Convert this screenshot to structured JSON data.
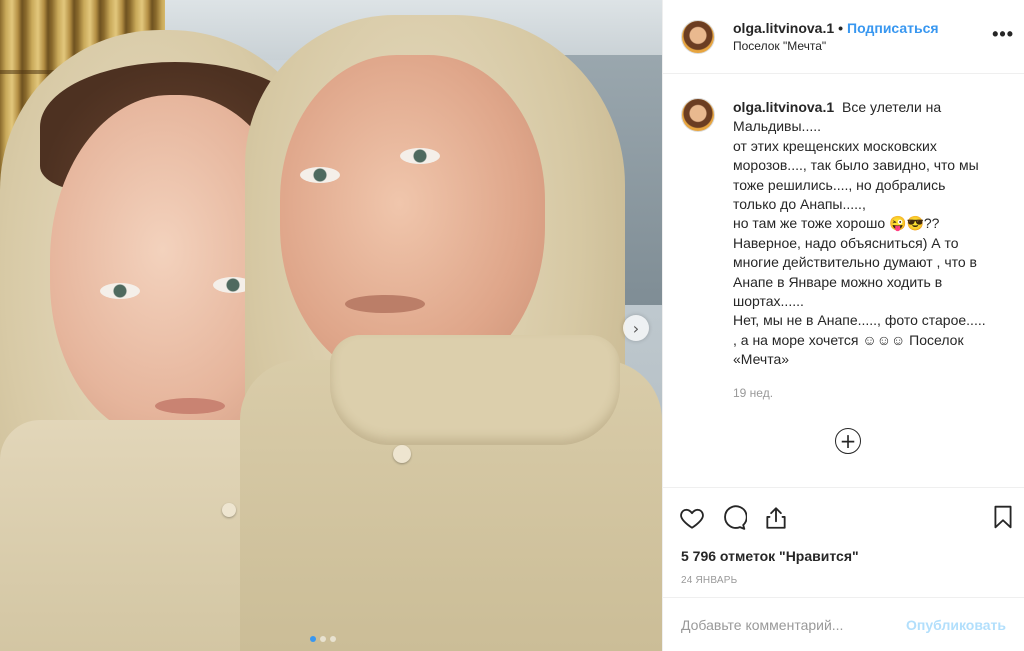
{
  "post": {
    "photo": {
      "carousel_dots": 3,
      "active_dot": 0,
      "next_icon": "chevron-right-icon"
    },
    "header": {
      "username": "olga.litvinova.1",
      "separator": "•",
      "follow_label": "Подписаться",
      "location": "Поселок \"Мечта\"",
      "more_icon": "more-dots-icon",
      "more_label": "•••"
    },
    "caption": {
      "username": "olga.litvinova.1",
      "lines": [
        "Все улетели на",
        "Мальдивы.....",
        "от этих крещенских московских",
        "морозов...., так было завидно, что мы",
        "тоже решились...., но добрались",
        "только до Анапы.....,",
        "но там же тоже хорошо 😜😎??",
        "Наверное, надо объясниться) А то",
        "многие действительно думают , что в",
        "Анапе в Январе можно ходить в",
        "шортах......",
        "Нет, мы не в Анапе....., фото старое.....",
        ", а на море хочется ☺☺☺ Поселок",
        "«Мечта»"
      ],
      "time": "19 нед."
    },
    "load_more_icon": "plus-circle-icon",
    "load_more_label": "+",
    "actions": {
      "like_icon": "heart-icon",
      "comment_icon": "comment-bubble-icon",
      "share_icon": "share-upload-icon",
      "save_icon": "bookmark-icon"
    },
    "likes_text": "5 796 отметок \"Нравится\"",
    "date": "24 ЯНВАРЬ",
    "comment_box": {
      "placeholder": "Добавьте комментарий...",
      "publish_label": "Опубликовать"
    },
    "colors": {
      "accent": "#3897f0",
      "publish_disabled": "#b2dffc",
      "muted": "#999999",
      "text": "#262626"
    }
  }
}
